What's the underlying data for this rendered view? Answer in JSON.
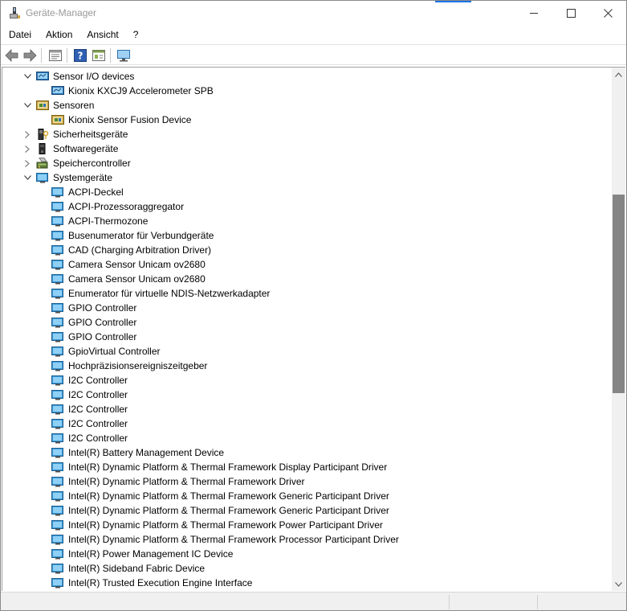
{
  "window": {
    "title": "Geräte-Manager",
    "accent_color": "#1a73e8"
  },
  "menu": [
    {
      "label": "Datei"
    },
    {
      "label": "Aktion"
    },
    {
      "label": "Ansicht"
    },
    {
      "label": "?"
    }
  ],
  "toolbar": {
    "buttons": [
      "back-icon",
      "forward-icon",
      "properties-icon",
      "help-icon",
      "details-icon",
      "monitor-icon"
    ]
  },
  "tree": {
    "items": [
      {
        "level": 0,
        "state": "expanded",
        "icon": "sensor-io-icon",
        "label": "Sensor I/O devices"
      },
      {
        "level": 1,
        "icon": "sensor-device-icon",
        "label": "Kionix KXCJ9 Accelerometer SPB"
      },
      {
        "level": 0,
        "state": "expanded",
        "icon": "sensors-icon",
        "label": "Sensoren"
      },
      {
        "level": 1,
        "icon": "sensors-icon",
        "label": "Kionix Sensor Fusion Device"
      },
      {
        "level": 0,
        "state": "collapsed",
        "icon": "security-icon",
        "label": "Sicherheitsgeräte"
      },
      {
        "level": 0,
        "state": "collapsed",
        "icon": "software-device-icon",
        "label": "Softwaregeräte"
      },
      {
        "level": 0,
        "state": "collapsed",
        "icon": "storage-controller-icon",
        "label": "Speichercontroller"
      },
      {
        "level": 0,
        "state": "expanded",
        "icon": "system-device-icon",
        "label": "Systemgeräte"
      },
      {
        "level": 1,
        "icon": "system-device-icon",
        "label": "ACPI-Deckel"
      },
      {
        "level": 1,
        "icon": "system-device-icon",
        "label": "ACPI-Prozessoraggregator"
      },
      {
        "level": 1,
        "icon": "system-device-icon",
        "label": "ACPI-Thermozone"
      },
      {
        "level": 1,
        "icon": "system-device-icon",
        "label": "Busenumerator für Verbundgeräte"
      },
      {
        "level": 1,
        "icon": "system-device-icon",
        "label": "CAD (Charging Arbitration Driver)"
      },
      {
        "level": 1,
        "icon": "system-device-icon",
        "label": "Camera Sensor Unicam ov2680"
      },
      {
        "level": 1,
        "icon": "system-device-icon",
        "label": "Camera Sensor Unicam ov2680"
      },
      {
        "level": 1,
        "icon": "system-device-icon",
        "label": "Enumerator für virtuelle NDIS-Netzwerkadapter"
      },
      {
        "level": 1,
        "icon": "system-device-icon",
        "label": "GPIO Controller"
      },
      {
        "level": 1,
        "icon": "system-device-icon",
        "label": "GPIO Controller"
      },
      {
        "level": 1,
        "icon": "system-device-icon",
        "label": "GPIO Controller"
      },
      {
        "level": 1,
        "icon": "system-device-icon",
        "label": "GpioVirtual Controller"
      },
      {
        "level": 1,
        "icon": "system-device-icon",
        "label": "Hochpräzisionsereigniszeitgeber"
      },
      {
        "level": 1,
        "icon": "system-device-icon",
        "label": "I2C Controller"
      },
      {
        "level": 1,
        "icon": "system-device-icon",
        "label": "I2C Controller"
      },
      {
        "level": 1,
        "icon": "system-device-icon",
        "label": "I2C Controller"
      },
      {
        "level": 1,
        "icon": "system-device-icon",
        "label": "I2C Controller"
      },
      {
        "level": 1,
        "icon": "system-device-icon",
        "label": "I2C Controller"
      },
      {
        "level": 1,
        "icon": "system-device-icon",
        "label": "Intel(R) Battery Management Device"
      },
      {
        "level": 1,
        "icon": "system-device-icon",
        "label": "Intel(R) Dynamic Platform & Thermal Framework Display Participant Driver"
      },
      {
        "level": 1,
        "icon": "system-device-icon",
        "label": "Intel(R) Dynamic Platform & Thermal Framework Driver"
      },
      {
        "level": 1,
        "icon": "system-device-icon",
        "label": "Intel(R) Dynamic Platform & Thermal Framework Generic Participant Driver"
      },
      {
        "level": 1,
        "icon": "system-device-icon",
        "label": "Intel(R) Dynamic Platform & Thermal Framework Generic Participant Driver"
      },
      {
        "level": 1,
        "icon": "system-device-icon",
        "label": "Intel(R) Dynamic Platform & Thermal Framework Power Participant Driver"
      },
      {
        "level": 1,
        "icon": "system-device-icon",
        "label": "Intel(R) Dynamic Platform & Thermal Framework Processor Participant Driver"
      },
      {
        "level": 1,
        "icon": "system-device-icon",
        "label": "Intel(R) Power Management IC Device"
      },
      {
        "level": 1,
        "icon": "system-device-icon",
        "label": "Intel(R) Sideband Fabric Device"
      },
      {
        "level": 1,
        "icon": "system-device-icon",
        "label": "Intel(R) Trusted Execution Engine Interface"
      }
    ]
  },
  "scrollbar": {
    "position": 0.38,
    "visible_fraction": 0.4
  }
}
